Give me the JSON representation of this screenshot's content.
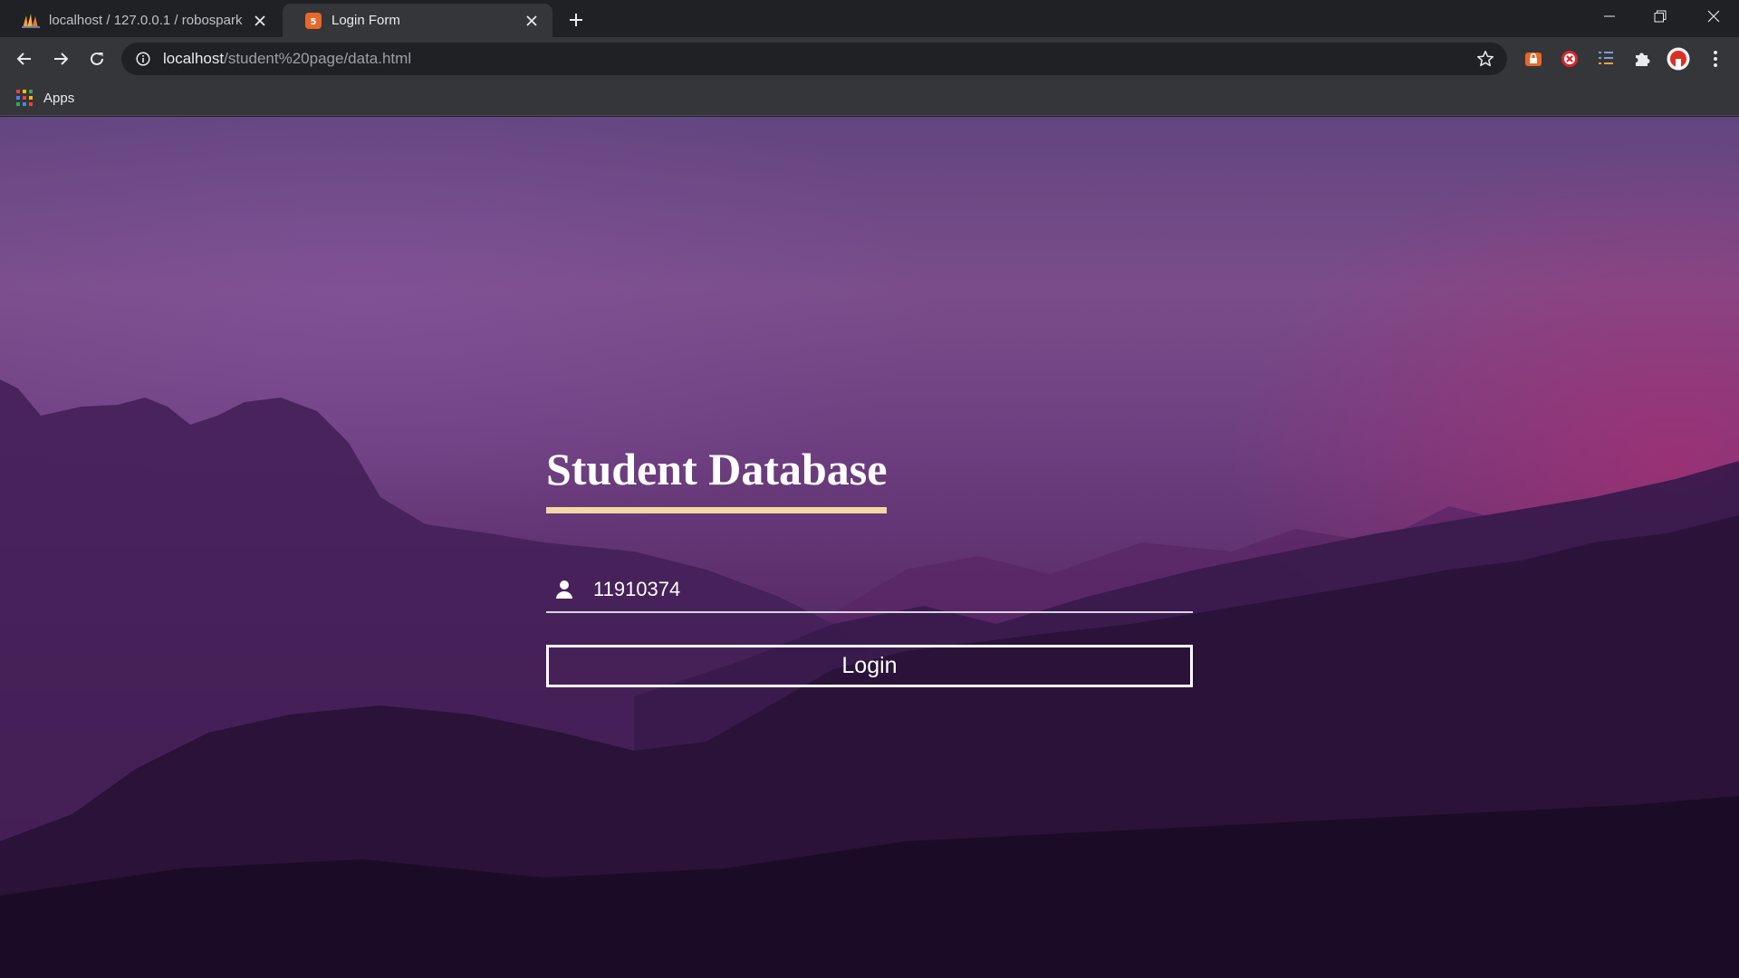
{
  "browser": {
    "tabs": [
      {
        "title": "localhost / 127.0.0.1 / robospark",
        "favicon": "phpmyadmin-icon",
        "active": false
      },
      {
        "title": "Login Form",
        "favicon": "html5-icon",
        "active": true
      }
    ],
    "address_bar": {
      "host": "localhost",
      "path": "/student%20page/data.html"
    },
    "bookmarks": [
      {
        "label": "Apps",
        "icon": "apps-grid-icon"
      }
    ],
    "extensions": [
      "lock-extension-icon",
      "adblock-icon",
      "reading-list-icon",
      "puzzle-icon",
      "profile-avatar-icon"
    ]
  },
  "page": {
    "title": "Student Database",
    "username_field": {
      "value": "11910374",
      "icon": "user-icon"
    },
    "login_button": "Login"
  },
  "colors": {
    "title_underline": "#f3d8a6",
    "chrome_dark": "#202124",
    "chrome_toolbar": "#35363a"
  }
}
